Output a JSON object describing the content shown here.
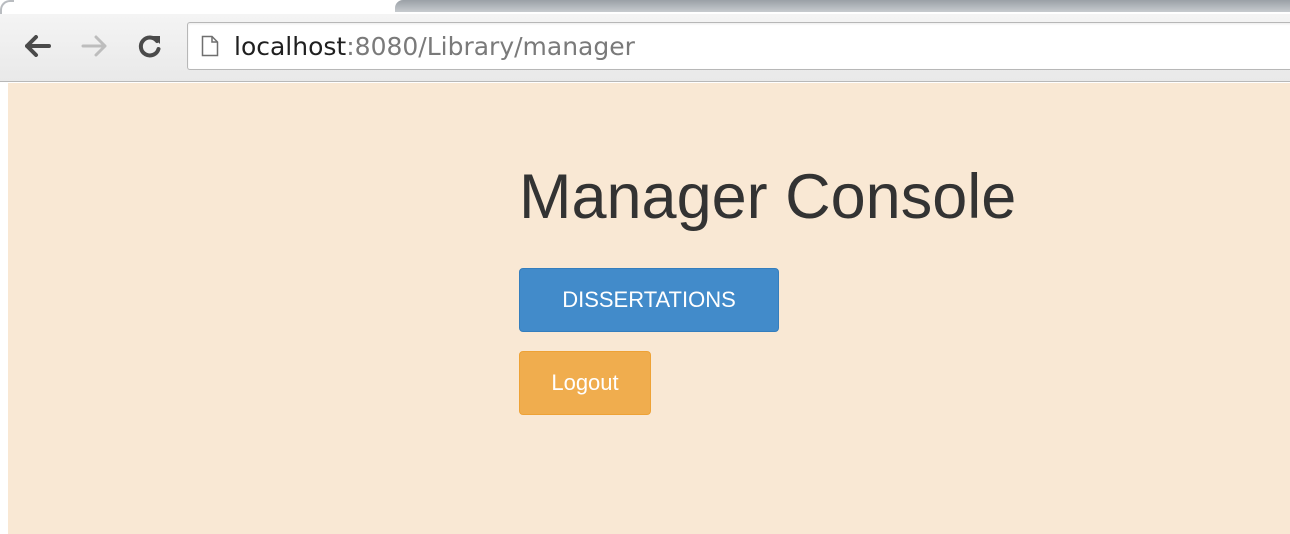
{
  "browser": {
    "nav": {
      "back_icon": "arrow-left-icon",
      "forward_icon": "arrow-right-icon",
      "reload_icon": "reload-icon"
    },
    "address": {
      "page_icon": "page-icon",
      "host": "localhost",
      "rest": ":8080/Library/manager"
    }
  },
  "page": {
    "background_color": "#f9e8d4",
    "title": "Manager Console",
    "buttons": {
      "dissertations_label": "DISSERTATIONS",
      "dissertations_color": "#428bca",
      "logout_label": "Logout",
      "logout_color": "#f0ad4e"
    }
  }
}
